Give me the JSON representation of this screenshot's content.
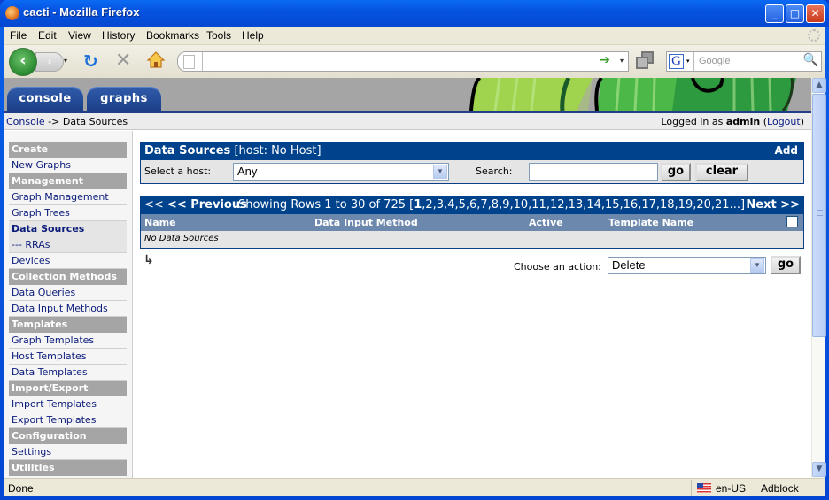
{
  "window": {
    "title": "cacti - Mozilla Firefox",
    "controls": {
      "minimize": "_",
      "maximize": "□",
      "close": "✕"
    }
  },
  "menubar": [
    "File",
    "Edit",
    "View",
    "History",
    "Bookmarks",
    "Tools",
    "Help"
  ],
  "navbar": {
    "url_value": "",
    "search_placeholder": "Google",
    "search_engine": "G",
    "icons": {
      "back": "‹",
      "forward": "›",
      "reload": "↻",
      "stop": "✕",
      "go": "➔",
      "dropdown": "▾",
      "search": "🔍"
    }
  },
  "app": {
    "tabs": [
      {
        "label": "console",
        "active": true
      },
      {
        "label": "graphs",
        "active": false
      }
    ],
    "breadcrumb": {
      "root": "Console",
      "separator": " -> ",
      "current": "Data Sources"
    },
    "login": {
      "prefix": "Logged in as ",
      "user": "admin",
      "logout": "Logout"
    }
  },
  "sidebar": [
    {
      "type": "header",
      "label": "Create"
    },
    {
      "type": "item",
      "label": "New Graphs"
    },
    {
      "type": "header",
      "label": "Management"
    },
    {
      "type": "item",
      "label": "Graph Management"
    },
    {
      "type": "item",
      "label": "Graph Trees"
    },
    {
      "type": "item",
      "label": "Data Sources",
      "active": true
    },
    {
      "type": "item",
      "label": "--- RRAs"
    },
    {
      "type": "item",
      "label": "Devices"
    },
    {
      "type": "header",
      "label": "Collection Methods"
    },
    {
      "type": "item",
      "label": "Data Queries"
    },
    {
      "type": "item",
      "label": "Data Input Methods"
    },
    {
      "type": "header",
      "label": "Templates"
    },
    {
      "type": "item",
      "label": "Graph Templates"
    },
    {
      "type": "item",
      "label": "Host Templates"
    },
    {
      "type": "item",
      "label": "Data Templates"
    },
    {
      "type": "header",
      "label": "Import/Export"
    },
    {
      "type": "item",
      "label": "Import Templates"
    },
    {
      "type": "item",
      "label": "Export Templates"
    },
    {
      "type": "header",
      "label": "Configuration"
    },
    {
      "type": "item",
      "label": "Settings"
    },
    {
      "type": "header",
      "label": "Utilities"
    }
  ],
  "filter_panel": {
    "title": "Data Sources",
    "subtitle": "[host: No Host]",
    "add_label": "Add",
    "host_label": "Select a host:",
    "host_value": "Any",
    "search_label": "Search:",
    "search_value": "",
    "go_label": "go",
    "clear_label": "clear"
  },
  "results": {
    "prev_label": "<< Previous",
    "showing_prefix": "Showing Rows 1 to 30 of 725 [",
    "current_page": "1",
    "pages_rest": ",2,3,4,5,6,7,8,9,10,11,12,13,14,15,16,17,18,19,20,21...]",
    "next_label": "Next >>",
    "columns": [
      "Name",
      "Data Input Method",
      "Active",
      "Template Name"
    ],
    "empty_message": "No Data Sources"
  },
  "action": {
    "label": "Choose an action:",
    "value": "Delete",
    "go_label": "go"
  },
  "statusbar": {
    "status": "Done",
    "locale": "en-US",
    "addon": "Adblock"
  }
}
